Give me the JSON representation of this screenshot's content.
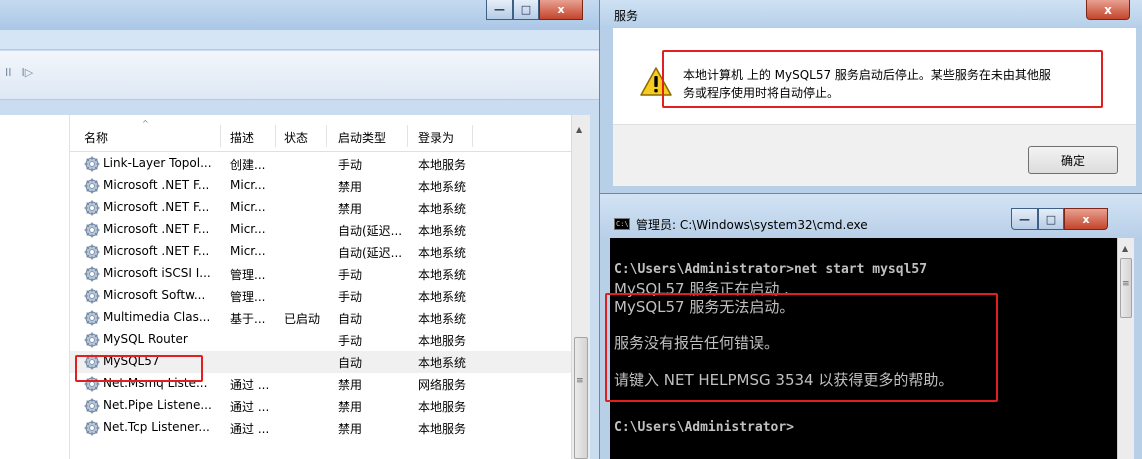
{
  "services_window": {
    "caption_buttons": {
      "minimize": "—",
      "maximize": "□",
      "close": "x"
    },
    "media_controls": [
      "II",
      "I▷"
    ],
    "columns": [
      "名称",
      "描述",
      "状态",
      "启动类型",
      "登录为"
    ],
    "rows": [
      {
        "name": "Link-Layer Topol...",
        "desc": "创建...",
        "status": "",
        "startup": "手动",
        "logon": "本地服务"
      },
      {
        "name": "Microsoft .NET F...",
        "desc": "Micr...",
        "status": "",
        "startup": "禁用",
        "logon": "本地系统"
      },
      {
        "name": "Microsoft .NET F...",
        "desc": "Micr...",
        "status": "",
        "startup": "禁用",
        "logon": "本地系统"
      },
      {
        "name": "Microsoft .NET F...",
        "desc": "Micr...",
        "status": "",
        "startup": "自动(延迟...",
        "logon": "本地系统"
      },
      {
        "name": "Microsoft .NET F...",
        "desc": "Micr...",
        "status": "",
        "startup": "自动(延迟...",
        "logon": "本地系统"
      },
      {
        "name": "Microsoft iSCSI I...",
        "desc": "管理...",
        "status": "",
        "startup": "手动",
        "logon": "本地系统"
      },
      {
        "name": "Microsoft Softw...",
        "desc": "管理...",
        "status": "",
        "startup": "手动",
        "logon": "本地系统"
      },
      {
        "name": "Multimedia Clas...",
        "desc": "基于...",
        "status": "已启动",
        "startup": "自动",
        "logon": "本地系统"
      },
      {
        "name": "MySQL Router",
        "desc": "",
        "status": "",
        "startup": "手动",
        "logon": "本地服务"
      },
      {
        "name": "MySQL57",
        "desc": "",
        "status": "",
        "startup": "自动",
        "logon": "本地系统"
      },
      {
        "name": "Net.Msmq Liste...",
        "desc": "通过 ...",
        "status": "",
        "startup": "禁用",
        "logon": "网络服务"
      },
      {
        "name": "Net.Pipe Listene...",
        "desc": "通过 ...",
        "status": "",
        "startup": "禁用",
        "logon": "本地服务"
      },
      {
        "name": "Net.Tcp Listener...",
        "desc": "通过 ...",
        "status": "",
        "startup": "禁用",
        "logon": "本地服务"
      }
    ],
    "selected_row": "MySQL57"
  },
  "dialog": {
    "title": "服务",
    "close_label": "x",
    "message_line1": "本地计算机 上的 MySQL57 服务启动后停止。某些服务在未由其他服",
    "message_line2": "务或程序使用时将自动停止。",
    "ok_label": "确定",
    "icon": "warning-icon"
  },
  "cmd": {
    "title": "管理员: C:\\Windows\\system32\\cmd.exe",
    "icon_text": "C:\\",
    "caption_buttons": {
      "minimize": "—",
      "maximize": "□",
      "close": "x"
    },
    "lines": [
      "C:\\Users\\Administrator>net start mysql57",
      "MySQL57 服务正在启动 .",
      "MySQL57 服务无法启动。",
      "服务没有报告任何错误。",
      "请键入 NET HELPMSG 3534 以获得更多的帮助。",
      "C:\\Users\\Administrator>"
    ]
  },
  "colors": {
    "highlight_red": "#e02020",
    "terminal_bg": "#000000",
    "terminal_fg": "#c0c0c0"
  }
}
